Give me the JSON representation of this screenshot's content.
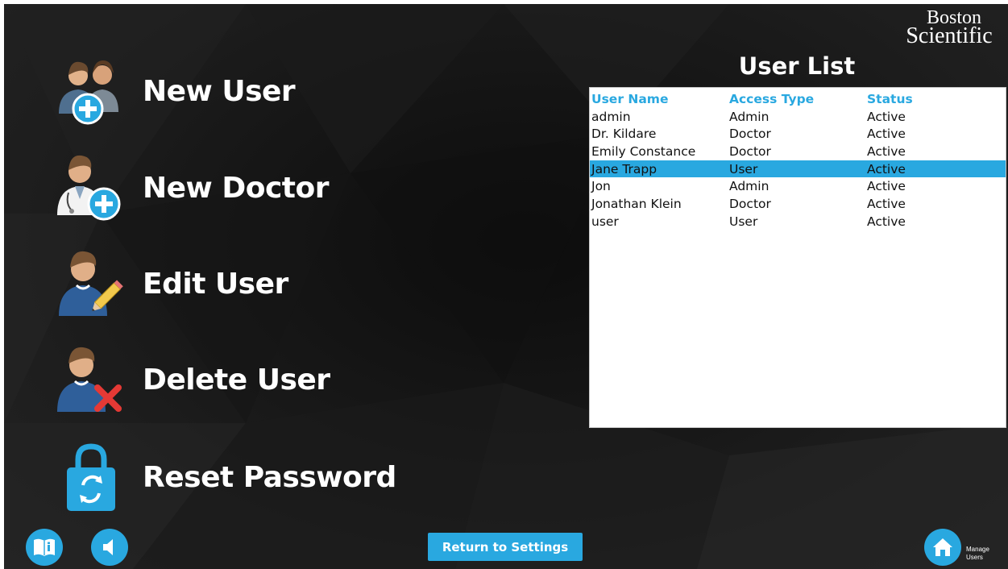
{
  "brand": {
    "line1": "Boston",
    "line2": "Scientific"
  },
  "actions": [
    {
      "label": "New User",
      "icon": "new-user-icon"
    },
    {
      "label": "New Doctor",
      "icon": "new-doctor-icon"
    },
    {
      "label": "Edit User",
      "icon": "edit-user-icon"
    },
    {
      "label": "Delete User",
      "icon": "delete-user-icon"
    },
    {
      "label": "Reset Password",
      "icon": "reset-password-icon"
    }
  ],
  "user_list": {
    "title": "User List",
    "columns": [
      "User Name",
      "Access Type",
      "Status"
    ],
    "selected_index": 3,
    "rows": [
      {
        "name": "admin",
        "access": "Admin",
        "status": "Active"
      },
      {
        "name": "Dr. Kildare",
        "access": "Doctor",
        "status": "Active"
      },
      {
        "name": "Emily Constance",
        "access": "Doctor",
        "status": "Active"
      },
      {
        "name": "Jane Trapp",
        "access": "User",
        "status": "Active"
      },
      {
        "name": "Jon",
        "access": "Admin",
        "status": "Active"
      },
      {
        "name": "Jonathan Klein",
        "access": "Doctor",
        "status": "Active"
      },
      {
        "name": "user",
        "access": "User",
        "status": "Active"
      }
    ]
  },
  "footer": {
    "return_label": "Return to Settings",
    "home_caption_line1": "Manage",
    "home_caption_line2": "Users",
    "info_icon": "book-info-icon",
    "sound_icon": "speaker-icon",
    "home_icon": "home-icon"
  },
  "colors": {
    "accent": "#29a8e0",
    "background": "#1a1a1a",
    "delete_red": "#e53935"
  }
}
